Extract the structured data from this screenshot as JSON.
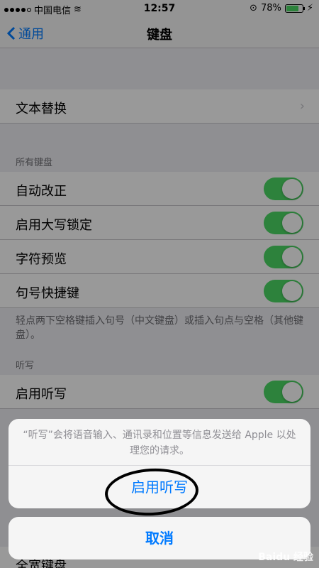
{
  "status_bar": {
    "carrier": "中国电信",
    "time": "12:57",
    "battery": "78%",
    "battery_level": 0.78
  },
  "nav": {
    "back_label": "通用",
    "title": "键盘"
  },
  "rows": {
    "text_replace": "文本替换",
    "all_keyboards_header": "所有键盘",
    "auto_correct": "自动改正",
    "caps_lock": "启用大写锁定",
    "char_preview": "字符预览",
    "period_shortcut": "句号快捷键",
    "period_note": "轻点两下空格键插入句号（中文键盘）或插入句点与空格（其他键盘）。",
    "dictation_header": "听写",
    "enable_dictation": "启用听写",
    "bottom_partial": "全宽键盘"
  },
  "toggles": {
    "auto_correct": true,
    "caps_lock": true,
    "char_preview": true,
    "period_shortcut": true,
    "enable_dictation": true
  },
  "sheet": {
    "message": "“听写”会将语音输入、通讯录和位置等信息发送给 Apple 以处理您的请求。",
    "enable_label": "启用听写",
    "cancel_label": "取消"
  },
  "watermark": "Baidu 经验",
  "colors": {
    "accent": "#007aff",
    "toggle_on": "#4cd964"
  }
}
